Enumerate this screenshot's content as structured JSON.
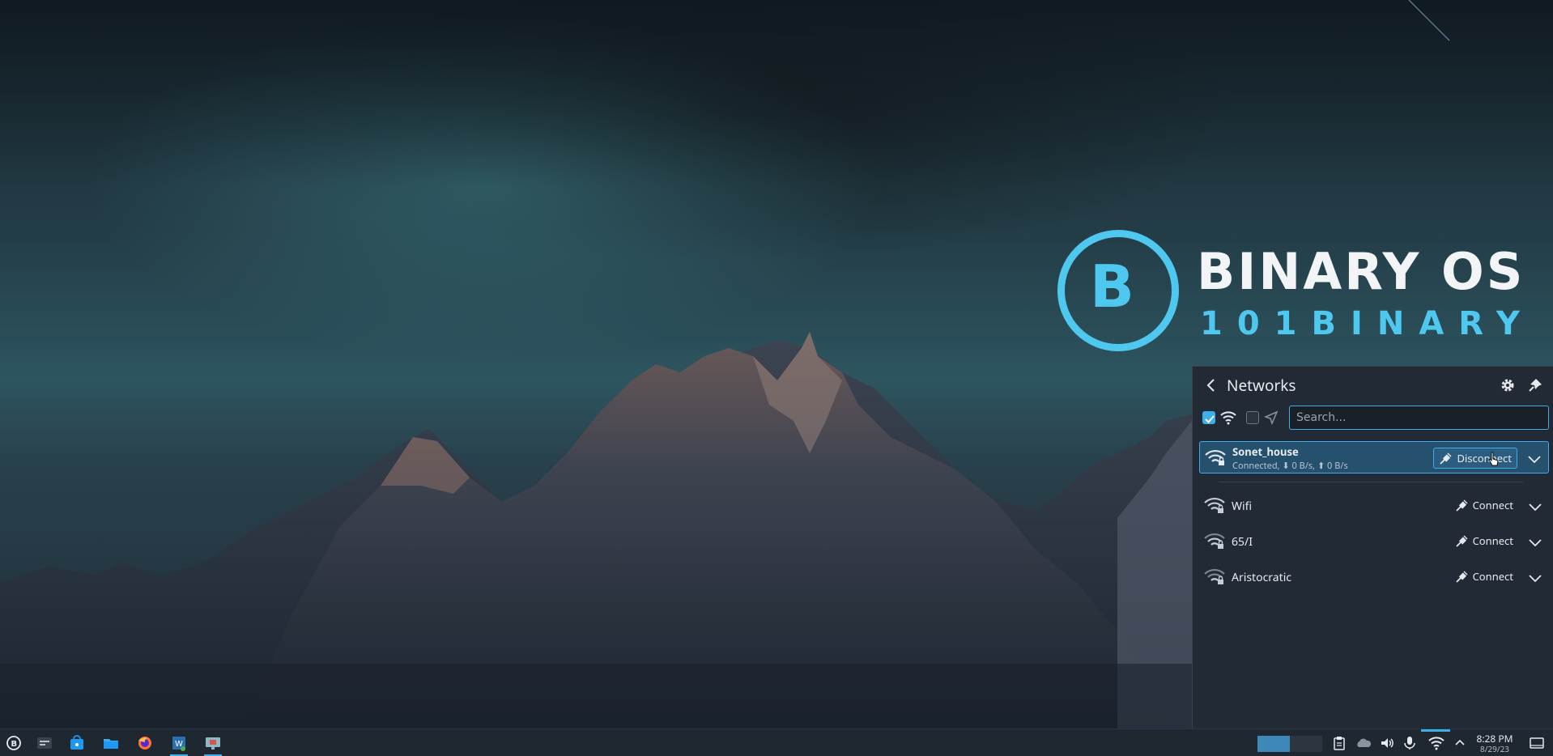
{
  "wallpaper": {
    "logo_title": "BINARY OS",
    "logo_subtitle": "101BINARY",
    "logo_mark": "B"
  },
  "networks_panel": {
    "title": "Networks",
    "back_icon": "chevron-left-icon",
    "settings_icon": "gear-icon",
    "pin_icon": "pin-icon",
    "wifi_enabled": true,
    "airplane_mode": false,
    "search_placeholder": "Search...",
    "connections": [
      {
        "name": "Sonet_house",
        "status": "Connected, ⬇ 0 B/s, ⬆ 0 B/s",
        "action": "Disconnect",
        "active": true,
        "secured": true
      },
      {
        "name": "Wifi",
        "action": "Connect",
        "active": false,
        "secured": true
      },
      {
        "name": "65/I",
        "action": "Connect",
        "active": false,
        "secured": true
      },
      {
        "name": "Aristocratic",
        "action": "Connect",
        "active": false,
        "secured": true
      }
    ]
  },
  "taskbar": {
    "launcher_icon": "binary-os-launcher-icon",
    "apps": [
      {
        "name": "system-settings-icon"
      },
      {
        "name": "discover-store-icon"
      },
      {
        "name": "file-manager-icon"
      },
      {
        "name": "firefox-icon"
      },
      {
        "name": "text-editor-icon"
      },
      {
        "name": "screen-recorder-icon"
      }
    ],
    "tray": [
      "clipboard-icon",
      "cloud-icon",
      "volume-icon",
      "microphone-icon",
      "network-wifi-icon",
      "chevron-up-icon"
    ],
    "clock_time": "8:28 PM",
    "clock_date": "8/29/23"
  },
  "colors": {
    "accent": "#3daee9",
    "logo": "#4fc8ef",
    "panel_bg": "#222b35"
  }
}
